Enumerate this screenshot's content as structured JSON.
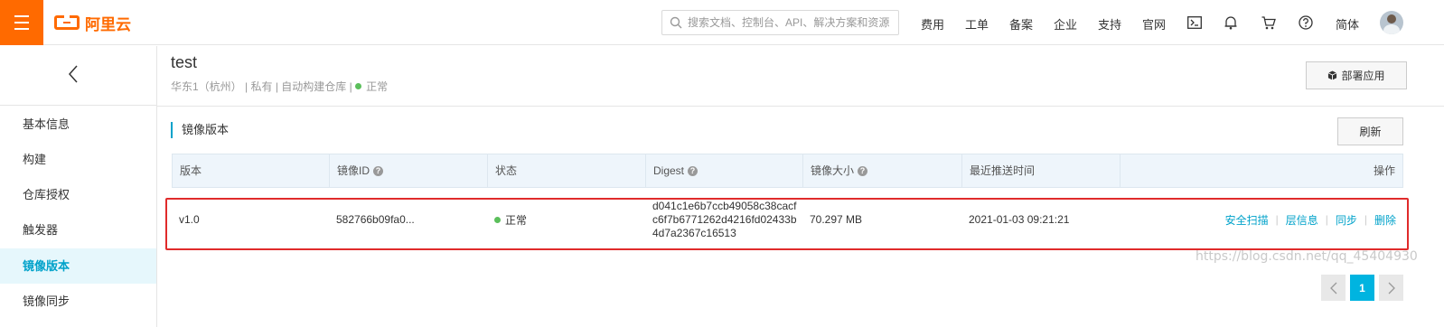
{
  "header": {
    "logo_text": "阿里云",
    "search_placeholder": "搜索文档、控制台、API、解决方案和资源",
    "nav": [
      "费用",
      "工单",
      "备案",
      "企业",
      "支持",
      "官网"
    ],
    "lang": "简体",
    "brand_color": "#ff6a00"
  },
  "sidebar": {
    "back_icon": "chevron-left-icon",
    "items": [
      {
        "label": "基本信息",
        "active": false
      },
      {
        "label": "构建",
        "active": false
      },
      {
        "label": "仓库授权",
        "active": false
      },
      {
        "label": "触发器",
        "active": false
      },
      {
        "label": "镜像版本",
        "active": true
      },
      {
        "label": "镜像同步",
        "active": false
      }
    ]
  },
  "repo": {
    "name": "test",
    "region": "华东1（杭州）",
    "visibility": "私有",
    "build_type": "自动构建仓库",
    "status": "正常",
    "deploy_label": "部署应用"
  },
  "section": {
    "title": "镜像版本",
    "refresh_label": "刷新"
  },
  "table": {
    "columns": [
      "版本",
      "镜像ID",
      "状态",
      "Digest",
      "镜像大小",
      "最近推送时间",
      "操作"
    ],
    "rows": [
      {
        "version": "v1.0",
        "image_id": "582766b09fa0...",
        "status": "正常",
        "digest": "d041c1e6b7ccb49058c38cacfc6f7b6771262d4216fd02433b4d7a2367c16513",
        "size": "70.297 MB",
        "pushed_at": "2021-01-03 09:21:21",
        "actions": [
          "安全扫描",
          "层信息",
          "同步",
          "删除"
        ]
      }
    ]
  },
  "pagination": {
    "current_page": "1"
  },
  "watermark": "https://blog.csdn.net/qq_45404930",
  "accent_color": "#00a2ca",
  "highlight_color": "#e02b2b"
}
